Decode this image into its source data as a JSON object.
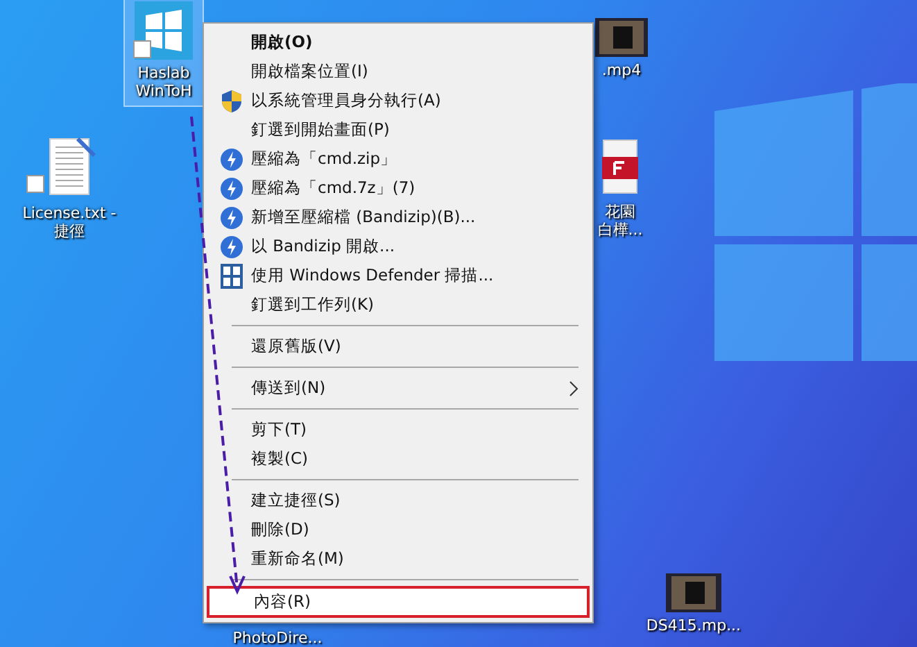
{
  "desktop_icons": [
    {
      "kind": "app",
      "label": [
        "Haslab",
        "WinToH"
      ],
      "selected": true,
      "shortcut": true
    },
    {
      "kind": "text",
      "label": [
        "License.txt -",
        "捷徑"
      ],
      "selected": false,
      "shortcut": true
    },
    {
      "kind": "video",
      "label": [
        ".mp4"
      ],
      "selected": false,
      "shortcut": false
    },
    {
      "kind": "pdf",
      "label": [
        "花園",
        "白樺..."
      ],
      "selected": false,
      "shortcut": false
    },
    {
      "kind": "label-only",
      "label": [
        "PhotoDire..."
      ],
      "selected": false,
      "shortcut": false
    },
    {
      "kind": "video",
      "label": [
        "DS415.mp..."
      ],
      "selected": false,
      "shortcut": false
    }
  ],
  "context_menu": {
    "groups": [
      [
        {
          "label": "開啟(O)",
          "kind": "plain",
          "submenu": false,
          "highlighted": false,
          "bold": true
        },
        {
          "label": "開啟檔案位置(I)",
          "kind": "plain",
          "submenu": false,
          "highlighted": false,
          "bold": false
        },
        {
          "label": "以系統管理員身分執行(A)",
          "kind": "shield",
          "submenu": false,
          "highlighted": false,
          "bold": false
        },
        {
          "label": "釘選到開始畫面(P)",
          "kind": "plain",
          "submenu": false,
          "highlighted": false,
          "bold": false
        },
        {
          "label": "壓縮為「cmd.zip」",
          "kind": "bandizip",
          "submenu": false,
          "highlighted": false,
          "bold": false
        },
        {
          "label": "壓縮為「cmd.7z」(7)",
          "kind": "bandizip",
          "submenu": false,
          "highlighted": false,
          "bold": false
        },
        {
          "label": "新增至壓縮檔 (Bandizip)(B)...",
          "kind": "bandizip",
          "submenu": false,
          "highlighted": false,
          "bold": false
        },
        {
          "label": "以 Bandizip 開啟...",
          "kind": "bandizip",
          "submenu": false,
          "highlighted": false,
          "bold": false
        },
        {
          "label": "使用 Windows Defender 掃描...",
          "kind": "defender",
          "submenu": false,
          "highlighted": false,
          "bold": false
        },
        {
          "label": "釘選到工作列(K)",
          "kind": "plain",
          "submenu": false,
          "highlighted": false,
          "bold": false
        }
      ],
      [
        {
          "label": "還原舊版(V)",
          "kind": "plain",
          "submenu": false,
          "highlighted": false,
          "bold": false
        }
      ],
      [
        {
          "label": "傳送到(N)",
          "kind": "plain",
          "submenu": true,
          "highlighted": false,
          "bold": false
        }
      ],
      [
        {
          "label": "剪下(T)",
          "kind": "plain",
          "submenu": false,
          "highlighted": false,
          "bold": false
        },
        {
          "label": "複製(C)",
          "kind": "plain",
          "submenu": false,
          "highlighted": false,
          "bold": false
        }
      ],
      [
        {
          "label": "建立捷徑(S)",
          "kind": "plain",
          "submenu": false,
          "highlighted": false,
          "bold": false
        },
        {
          "label": "刪除(D)",
          "kind": "plain",
          "submenu": false,
          "highlighted": false,
          "bold": false
        },
        {
          "label": "重新命名(M)",
          "kind": "plain",
          "submenu": false,
          "highlighted": false,
          "bold": false
        }
      ],
      [
        {
          "label": "內容(R)",
          "kind": "plain",
          "submenu": false,
          "highlighted": true,
          "bold": false
        }
      ]
    ]
  },
  "annotation": {
    "kind": "dashed-arrow"
  }
}
